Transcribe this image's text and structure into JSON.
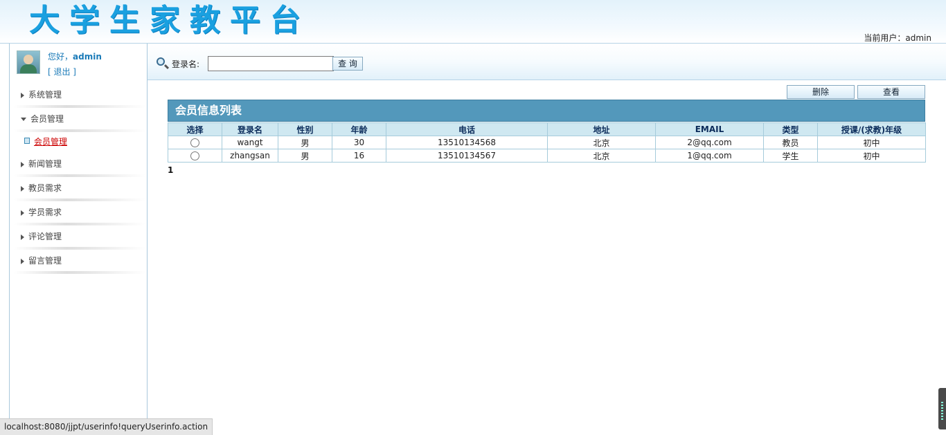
{
  "header": {
    "logo_text": "大学生家教平台",
    "current_user_label": "当前用户：",
    "current_user": "admin"
  },
  "sidebar": {
    "greeting": "您好，",
    "username": "admin",
    "logout": "[ 退出 ]",
    "menu": [
      {
        "label": "系统管理",
        "expanded": false
      },
      {
        "label": "会员管理",
        "expanded": true,
        "children": [
          {
            "label": "会员管理"
          }
        ]
      },
      {
        "label": "新闻管理",
        "expanded": false
      },
      {
        "label": "教员需求",
        "expanded": false
      },
      {
        "label": "学员需求",
        "expanded": false
      },
      {
        "label": "评论管理",
        "expanded": false
      },
      {
        "label": "留言管理",
        "expanded": false
      }
    ]
  },
  "search": {
    "label": "登录名:",
    "value": "",
    "button": "查 询"
  },
  "actions": {
    "delete": "删除",
    "view": "查看"
  },
  "panel": {
    "title": "会员信息列表"
  },
  "table": {
    "columns": [
      "选择",
      "登录名",
      "性别",
      "年龄",
      "电话",
      "地址",
      "EMAIL",
      "类型",
      "授课/(求教)年级"
    ],
    "rows": [
      [
        "",
        "wangt",
        "男",
        "30",
        "13510134568",
        "北京",
        "2@qq.com",
        "教员",
        "初中"
      ],
      [
        "",
        "zhangsan",
        "男",
        "16",
        "13510134567",
        "北京",
        "1@qq.com",
        "学生",
        "初中"
      ]
    ]
  },
  "pager": {
    "current": "1"
  },
  "status": {
    "url": "localhost:8080/jjpt/userinfo!queryUserinfo.action"
  },
  "colors": {
    "logo": "#1aa0e0",
    "panel_header": "#5398bb",
    "table_header": "#cfe8f1",
    "link_active": "#cc0000"
  }
}
